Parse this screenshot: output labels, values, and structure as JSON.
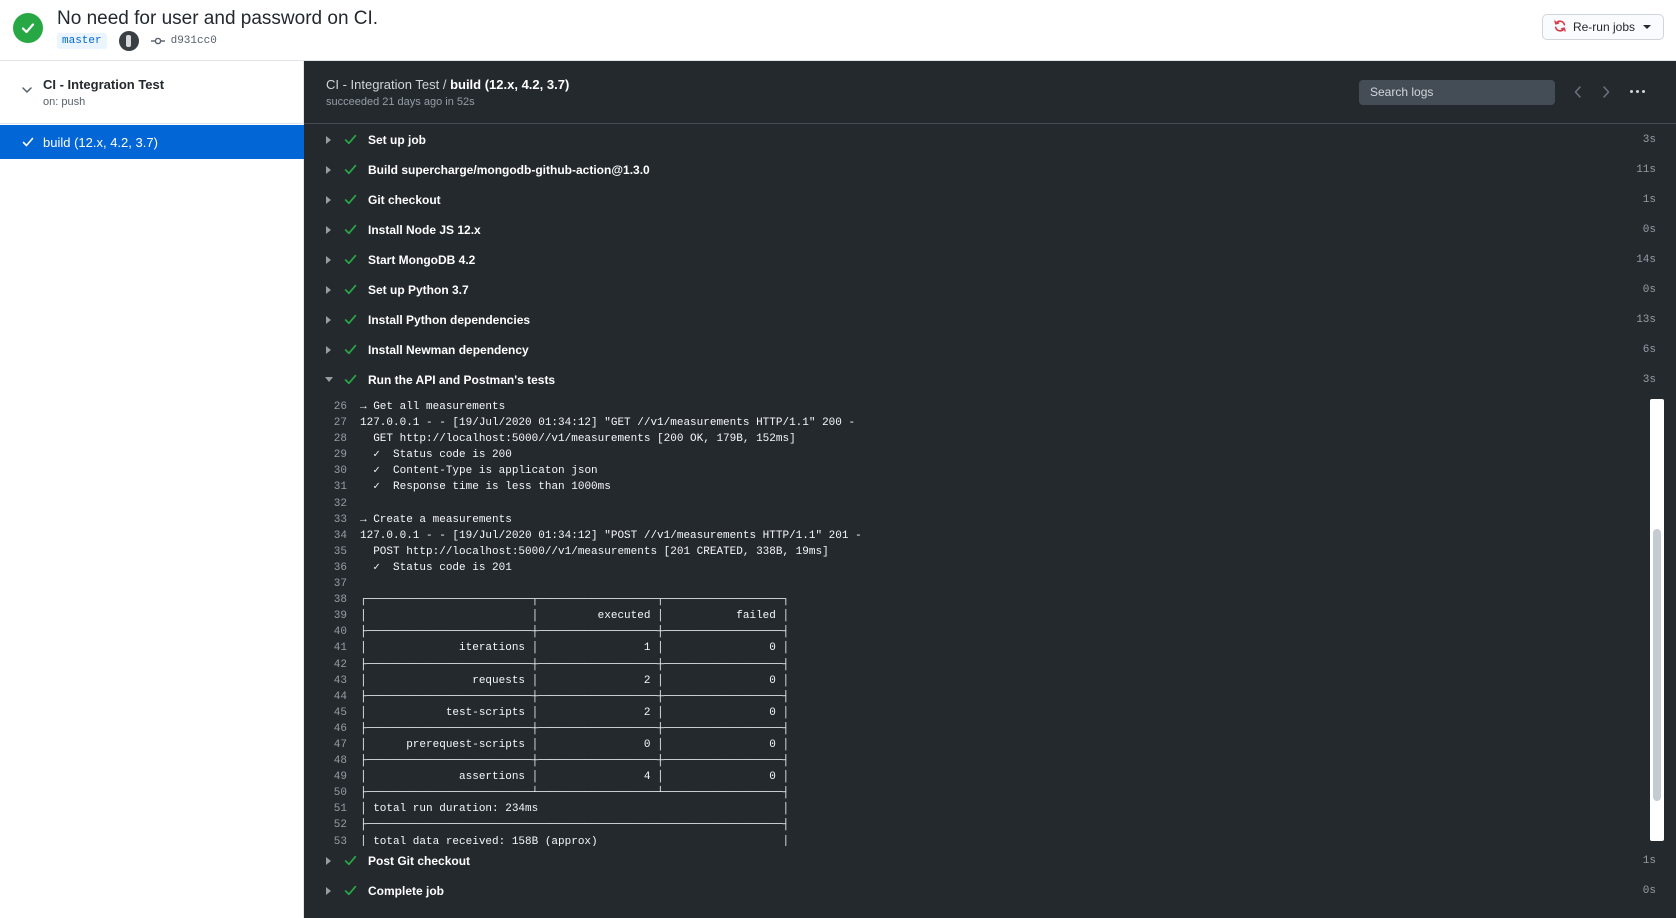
{
  "header": {
    "commit_title": "No need for user and password on CI.",
    "branch": "master",
    "sha": "d931cc0",
    "rerun_label": "Re-run jobs",
    "status_color": "#28a745"
  },
  "sidebar": {
    "workflow_name": "CI - Integration Test",
    "trigger": "on: push",
    "job_label": "build (12.x, 4.2, 3.7)"
  },
  "main": {
    "workflow_crumb": "CI - Integration Test /",
    "job_name": "build (12.x, 4.2, 3.7)",
    "subtitle": "succeeded 21 days ago in 52s",
    "search_placeholder": "Search logs"
  },
  "steps_before": [
    {
      "name": "Set up job",
      "duration": "3s"
    },
    {
      "name": "Build supercharge/mongodb-github-action@1.3.0",
      "duration": "11s"
    },
    {
      "name": "Git checkout",
      "duration": "1s"
    },
    {
      "name": "Install Node JS 12.x",
      "duration": "0s"
    },
    {
      "name": "Start MongoDB 4.2",
      "duration": "14s"
    },
    {
      "name": "Set up Python 3.7",
      "duration": "0s"
    },
    {
      "name": "Install Python dependencies",
      "duration": "13s"
    },
    {
      "name": "Install Newman dependency",
      "duration": "6s"
    }
  ],
  "expanded_step": {
    "name": "Run the API and Postman's tests",
    "duration": "3s"
  },
  "log_lines": [
    {
      "n": "26",
      "t": "→ Get all measurements"
    },
    {
      "n": "27",
      "t": "127.0.0.1 - - [19/Jul/2020 01:34:12] \"GET //v1/measurements HTTP/1.1\" 200 -"
    },
    {
      "n": "28",
      "t": "  GET http://localhost:5000//v1/measurements [200 OK, 179B, 152ms]"
    },
    {
      "n": "29",
      "t": "  ✓  Status code is 200"
    },
    {
      "n": "30",
      "t": "  ✓  Content-Type is applicaton json"
    },
    {
      "n": "31",
      "t": "  ✓  Response time is less than 1000ms"
    },
    {
      "n": "32",
      "t": ""
    },
    {
      "n": "33",
      "t": "→ Create a measurements"
    },
    {
      "n": "34",
      "t": "127.0.0.1 - - [19/Jul/2020 01:34:12] \"POST //v1/measurements HTTP/1.1\" 201 -"
    },
    {
      "n": "35",
      "t": "  POST http://localhost:5000//v1/measurements [201 CREATED, 338B, 19ms]"
    },
    {
      "n": "36",
      "t": "  ✓  Status code is 201"
    },
    {
      "n": "37",
      "t": ""
    },
    {
      "n": "38",
      "t": "┌─────────────────────────┬──────────────────┬──────────────────┐"
    },
    {
      "n": "39",
      "t": "│                         │         executed │           failed │"
    },
    {
      "n": "40",
      "t": "├─────────────────────────┼──────────────────┼──────────────────┤"
    },
    {
      "n": "41",
      "t": "│              iterations │                1 │                0 │"
    },
    {
      "n": "42",
      "t": "├─────────────────────────┼──────────────────┼──────────────────┤"
    },
    {
      "n": "43",
      "t": "│                requests │                2 │                0 │"
    },
    {
      "n": "44",
      "t": "├─────────────────────────┼──────────────────┼──────────────────┤"
    },
    {
      "n": "45",
      "t": "│            test-scripts │                2 │                0 │"
    },
    {
      "n": "46",
      "t": "├─────────────────────────┼──────────────────┼──────────────────┤"
    },
    {
      "n": "47",
      "t": "│      prerequest-scripts │                0 │                0 │"
    },
    {
      "n": "48",
      "t": "├─────────────────────────┼──────────────────┼──────────────────┤"
    },
    {
      "n": "49",
      "t": "│              assertions │                4 │                0 │"
    },
    {
      "n": "50",
      "t": "├─────────────────────────┴──────────────────┴──────────────────┤"
    },
    {
      "n": "51",
      "t": "│ total run duration: 234ms                                     │"
    },
    {
      "n": "52",
      "t": "├───────────────────────────────────────────────────────────────┤"
    },
    {
      "n": "53",
      "t": "│ total data received: 158B (approx)                            │"
    }
  ],
  "steps_after": [
    {
      "name": "Post Git checkout",
      "duration": "1s"
    },
    {
      "name": "Complete job",
      "duration": "0s"
    }
  ],
  "icons": {
    "success": "check-icon",
    "rerun": "sync-icon",
    "commit": "git-commit-icon"
  },
  "colors": {
    "accent": "#0366d6",
    "success": "#28a745",
    "log_bg": "#24292e",
    "rerun_icon": "#d73a49"
  }
}
